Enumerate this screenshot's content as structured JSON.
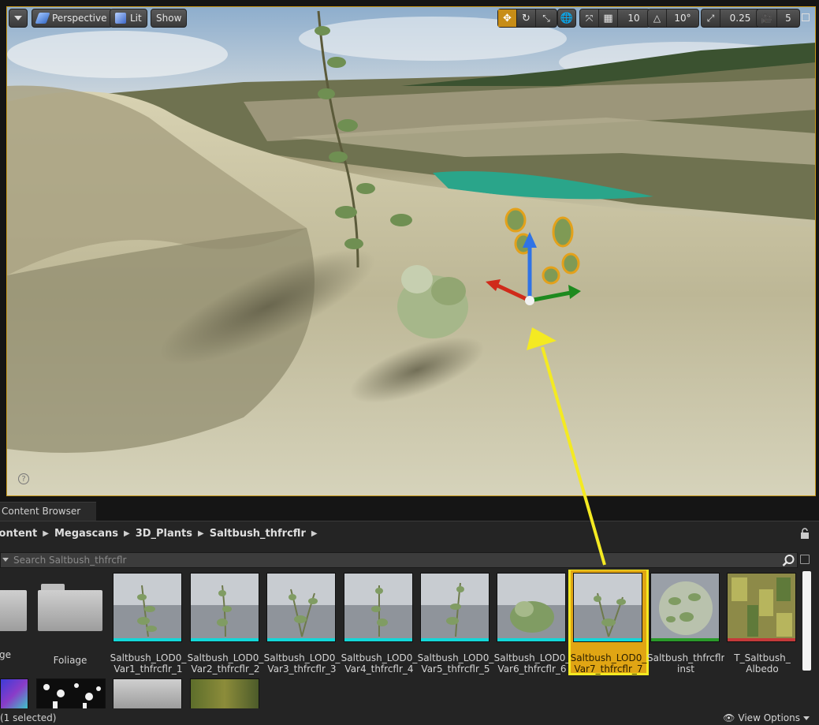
{
  "viewport": {
    "toolbar": {
      "perspective_label": "Perspective",
      "lit_label": "Lit",
      "show_label": "Show",
      "grid_snap_value": "10",
      "rotation_snap_value": "10°",
      "scale_snap_value": "0.25",
      "camera_speed_value": "5"
    },
    "help_glyph": "?"
  },
  "content_browser": {
    "tab_label": "Content Browser",
    "breadcrumb": [
      "Content",
      "Megascans",
      "3D_Plants",
      "Saltbush_thfrcflr"
    ],
    "search_placeholder": "Search Saltbush_thfrcflr",
    "folders": [
      {
        "label": "Foliage"
      },
      {
        "label": "Foliage"
      }
    ],
    "assets": [
      {
        "line1": "Saltbush_LOD0_",
        "line2": "Var1_thfrcflr_1"
      },
      {
        "line1": "Saltbush_LOD0_",
        "line2": "Var2_thfrcflr_2"
      },
      {
        "line1": "Saltbush_LOD0_",
        "line2": "Var3_thfrcflr_3"
      },
      {
        "line1": "Saltbush_LOD0_",
        "line2": "Var4_thfrcflr_4"
      },
      {
        "line1": "Saltbush_LOD0_",
        "line2": "Var5_thfrcflr_5"
      },
      {
        "line1": "Saltbush_LOD0_",
        "line2": "Var6_thfrcflr_6"
      },
      {
        "line1": "Saltbush_LOD0_",
        "line2": "Var7_thfrcflr_7"
      },
      {
        "line1": "Saltbush_thfrcflr_",
        "line2": "inst"
      },
      {
        "line1": "T_Saltbush_",
        "line2": "Albedo"
      }
    ],
    "status": "(1 selected)",
    "view_options_label": "View Options"
  },
  "colors": {
    "selection": "#e0a514",
    "selection_border": "#f4ea22",
    "annotation_arrow": "#f4ea22",
    "active_tool": "#c78d17"
  }
}
